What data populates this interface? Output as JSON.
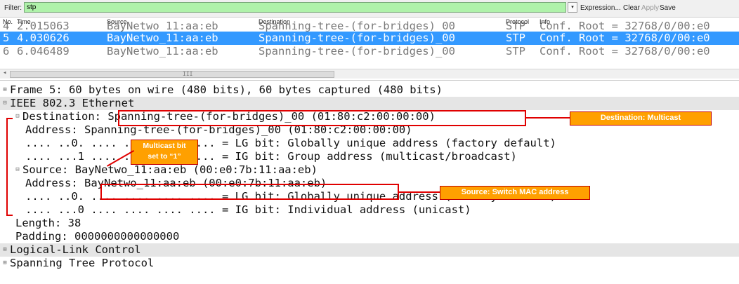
{
  "filter": {
    "label": "Filter:",
    "value": "stp",
    "dropdown_icon": "▾",
    "buttons": [
      "Expression...",
      "Clear",
      "Apply",
      "Save"
    ]
  },
  "columns": [
    "No.",
    "Time",
    "Source",
    "Destination",
    "Protocol",
    "Info"
  ],
  "packets": [
    {
      "no": "4",
      "time": "2.015063",
      "source": "BayNetwo_11:aa:eb",
      "destination": "Spanning-tree-(for-bridges)_00",
      "protocol": "STP",
      "info": "Conf. Root = 32768/0/00:e0"
    },
    {
      "no": "5",
      "time": "4.030626",
      "source": "BayNetwo_11:aa:eb",
      "destination": "Spanning-tree-(for-bridges)_00",
      "protocol": "STP",
      "info": "Conf. Root = 32768/0/00:e0"
    },
    {
      "no": "6",
      "time": "6.046489",
      "source": "BayNetwo_11:aa:eb",
      "destination": "Spanning-tree-(for-bridges)_00",
      "protocol": "STP",
      "info": "Conf. Root = 32768/0/00:e0"
    }
  ],
  "scroll_grip": "III",
  "details": [
    {
      "toggle": "⊞",
      "text": "Frame 5: 60 bytes on wire (480 bits), 60 bytes captured (480 bits)"
    },
    {
      "toggle": "⊟",
      "text": "IEEE 802.3 Ethernet"
    },
    {
      "toggle": "⊟",
      "text": "Destination: Spanning-tree-(for-bridges)_00 (01:80:c2:00:00:00)"
    },
    {
      "toggle": "",
      "text": "Address: Spanning-tree-(for-bridges)_00 (01:80:c2:00:00:00)"
    },
    {
      "toggle": "",
      "text": ".... ..0. .... .... .... .... = LG bit: Globally unique address (factory default)"
    },
    {
      "toggle": "",
      "text": ".... ...1 .... .... .... .... = IG bit: Group address (multicast/broadcast)"
    },
    {
      "toggle": "⊟",
      "text": "Source: BayNetwo_11:aa:eb (00:e0:7b:11:aa:eb)"
    },
    {
      "toggle": "",
      "text": "Address: BayNetwo_11:aa:eb (00:e0:7b:11:aa:eb)"
    },
    {
      "toggle": "",
      "text": ".... ..0. .... .... .... .... = LG bit: Globally unique address (factory default)"
    },
    {
      "toggle": "",
      "text": ".... ...0 .... .... .... .... = IG bit: Individual address (unicast)"
    },
    {
      "toggle": "",
      "text": "Length: 38"
    },
    {
      "toggle": "",
      "text": "Padding: 0000000000000000"
    },
    {
      "toggle": "⊞",
      "text": "Logical-Link Control"
    },
    {
      "toggle": "⊞",
      "text": "Spanning Tree Protocol"
    }
  ],
  "annotations": {
    "destination": "Destination: Multicast",
    "multicast_bit_line1": "Multicast bit",
    "multicast_bit_line2": "set to “1”",
    "source": "Source: Switch MAC address"
  },
  "colors": {
    "selected_row": "#3399ff",
    "filter_bg": "#aff2aa",
    "callout": "#ffa000",
    "annotation_red": "#e00000"
  }
}
